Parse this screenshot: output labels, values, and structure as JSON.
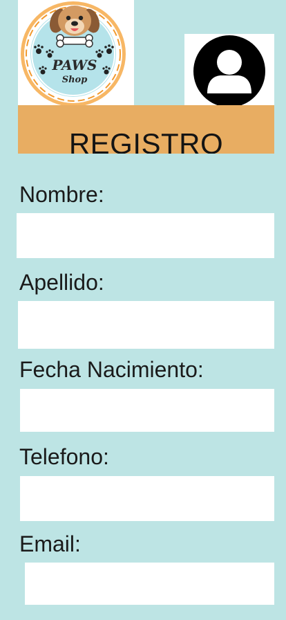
{
  "logo": {
    "brand_line1": "PAWS",
    "brand_line2": "Shop"
  },
  "header": {
    "title": "REGISTRO"
  },
  "form": {
    "nombre_label": "Nombre:",
    "nombre_value": "",
    "apellido_label": "Apellido:",
    "apellido_value": "",
    "fecha_label": "Fecha Nacimiento:",
    "fecha_value": "",
    "telefono_label": "Telefono:",
    "telefono_value": "",
    "email_label": "Email:",
    "email_value": ""
  },
  "colors": {
    "background": "#bde4e4",
    "header": "#e8ad62",
    "logo_ring_orange": "#f29a2e",
    "logo_inner": "#b5e3ea"
  },
  "icons": {
    "logo": "paws-shop-dog-logo",
    "avatar": "user-avatar-icon"
  }
}
